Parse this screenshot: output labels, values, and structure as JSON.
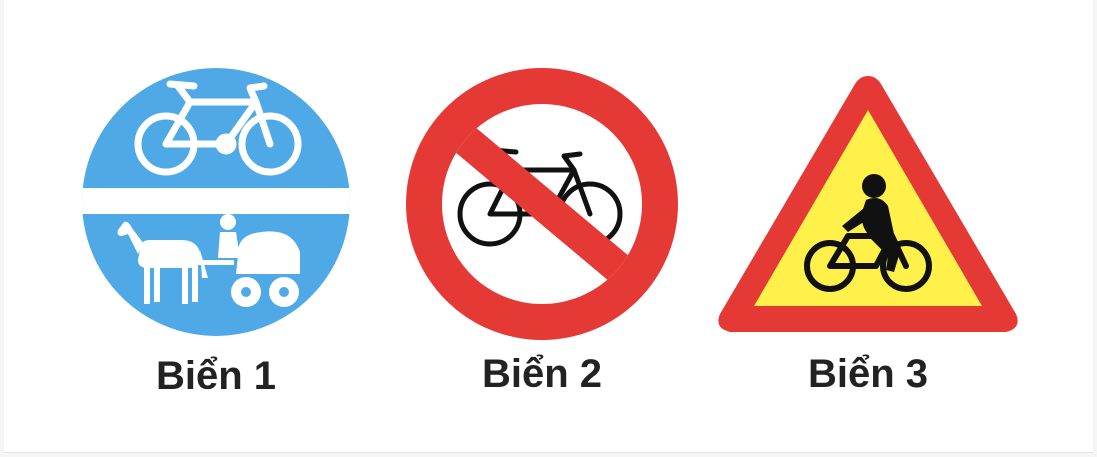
{
  "signs": [
    {
      "caption": "Biển 1",
      "icon": "bicycle-and-horse-cart-icon",
      "colors": {
        "background": "#4fa9e6",
        "symbol": "#ffffff"
      }
    },
    {
      "caption": "Biển 2",
      "icon": "no-bicycle-icon",
      "colors": {
        "ring": "#e53935",
        "field": "#ffffff",
        "symbol": "#111111"
      }
    },
    {
      "caption": "Biển 3",
      "icon": "cyclist-warning-icon",
      "colors": {
        "border": "#e53935",
        "field": "#fff14a",
        "symbol": "#111111"
      }
    }
  ]
}
